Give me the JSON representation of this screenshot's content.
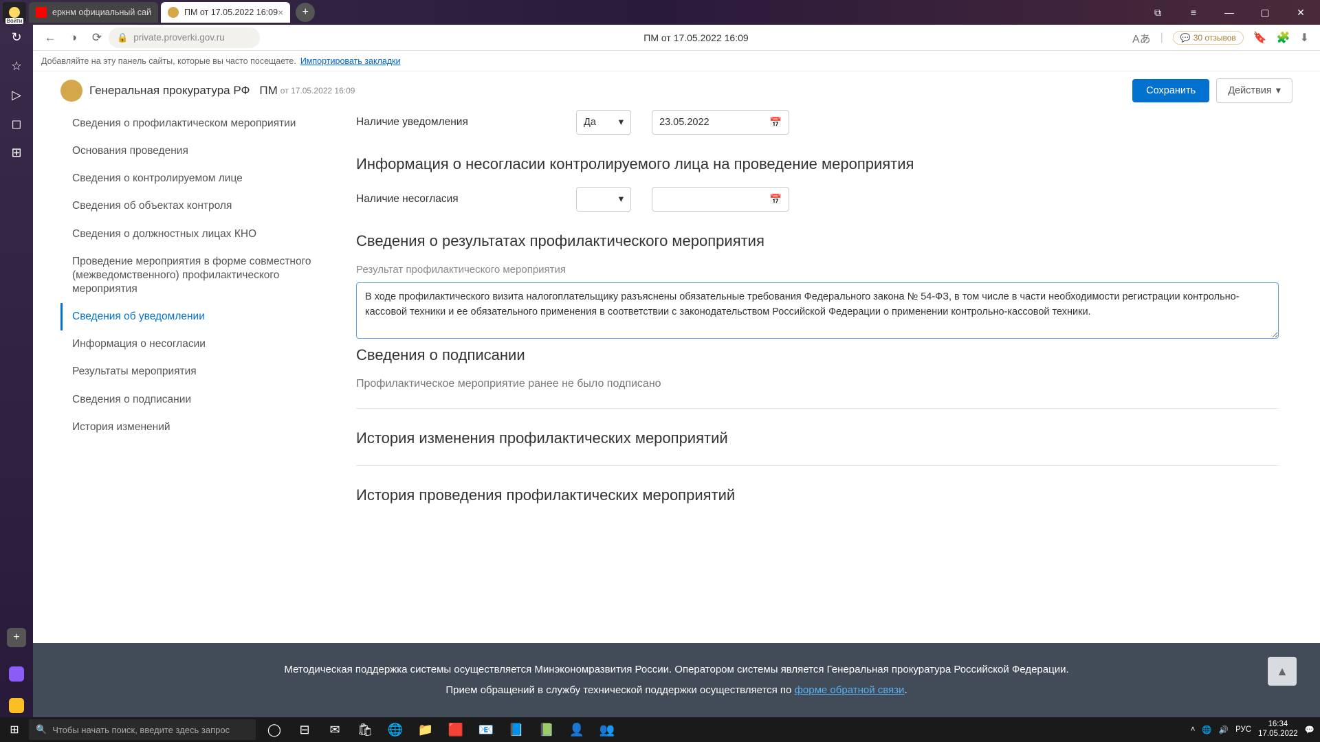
{
  "titlebar": {
    "profile_label": "Войти",
    "tabs": [
      {
        "label": "еркнм официальный сай",
        "active": false
      },
      {
        "label": "ПМ от 17.05.2022 16:09",
        "active": true
      }
    ]
  },
  "urlbar": {
    "url": "private.proverki.gov.ru",
    "page_title": "ПМ от 17.05.2022 16:09",
    "reviews": "30 отзывов"
  },
  "bookmarks_hint": {
    "text": "Добавляйте на эту панель сайты, которые вы часто посещаете.",
    "link": "Импортировать закладки"
  },
  "page_header": {
    "org": "Генеральная прокуратура РФ",
    "pm": "ПМ",
    "pm_date": "от 17.05.2022 16:09",
    "save": "Сохранить",
    "actions": "Действия"
  },
  "sidebar": {
    "items": [
      "Сведения о профилактическом мероприятии",
      "Основания проведения",
      "Сведения о контролируемом лице",
      "Сведения об объектах контроля",
      "Сведения о должностных лицах КНО",
      "Проведение мероприятия в форме совместного (межведомственного) профилактического мероприятия",
      "Сведения об уведомлении",
      "Информация о несогласии",
      "Результаты мероприятия",
      "Сведения о подписании",
      "История изменений"
    ],
    "active_index": 6
  },
  "form": {
    "row1_label": "Наличие уведомления",
    "row1_select": "Да",
    "row1_date": "23.05.2022",
    "heading1": "Информация о несогласии контролируемого лица на проведение мероприятия",
    "row2_label": "Наличие несогласия",
    "row2_select": "",
    "row2_date": "",
    "heading2": "Сведения о результатах профилактического мероприятия",
    "sub_label": "Результат профилактического мероприятия",
    "textarea_value": "В ходе профилактического визита налогоплательщику разъяснены обязательные требования Федерального закона № 54-ФЗ, в том числе в части необходимости регистрации контрольно-кассовой техники и ее обязательного применения в соответствии с законодательством Российской Федерации о применении контрольно-кассовой техники.",
    "heading3": "Сведения о подписании",
    "signed_text": "Профилактическое мероприятие ранее не было подписано",
    "heading4": "История изменения профилактических мероприятий",
    "heading5": "История проведения профилактических мероприятий"
  },
  "footer": {
    "line1": "Методическая поддержка системы осуществляется Минэкономразвития России. Оператором системы является Генеральная прокуратура Российской Федерации.",
    "line2_pre": "Прием обращений в службу технической поддержки осуществляется по ",
    "line2_link": "форме обратной связи",
    "line2_post": "."
  },
  "taskbar": {
    "search_placeholder": "Чтобы начать поиск, введите здесь запрос",
    "lang": "РУС",
    "time": "16:34",
    "date": "17.05.2022"
  }
}
